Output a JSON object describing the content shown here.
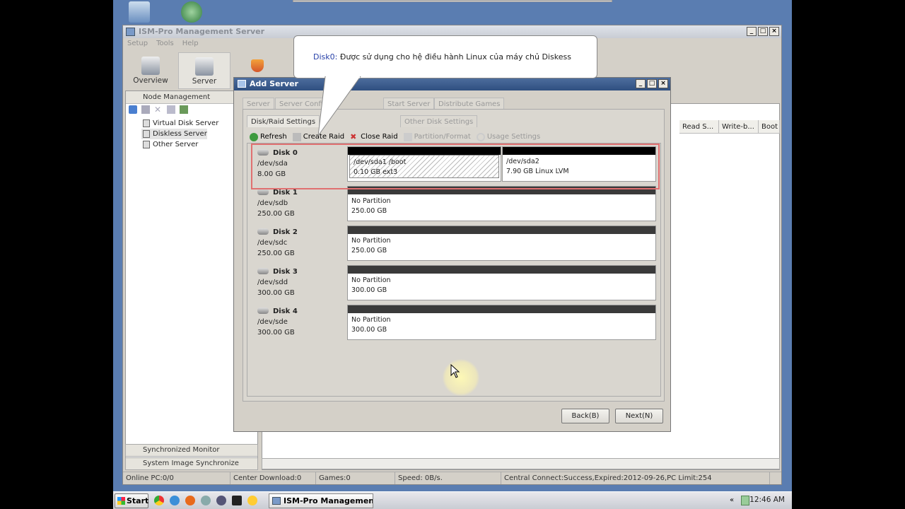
{
  "main_window": {
    "title": "ISM-Pro Management Server",
    "menu": [
      "Setup",
      "Tools",
      "Help"
    ],
    "nav": {
      "overview": "Overview",
      "server": "Server"
    }
  },
  "left_panel": {
    "header": "Node Management",
    "tree": [
      "Virtual Disk Server",
      "Diskless Server",
      "Other Server"
    ],
    "footer1": "Synchronized Monitor",
    "footer2": "System Image Synchronize"
  },
  "table_columns": [
    "Read S...",
    "Write-b...",
    "Boot"
  ],
  "status_bar": [
    "Online PC:0/0",
    "Center Download:0",
    "Games:0",
    "Speed: 0B/s.",
    "Central Connect:Success,Expired:2012-09-26,PC Limit:254"
  ],
  "dialog": {
    "title": "Add Server",
    "tabs": [
      "Server",
      "Server Config",
      "Start Server",
      "Distribute Games"
    ],
    "subtabs": [
      "Disk/Raid Settings",
      "Other Disk Settings"
    ],
    "toolbar": [
      "Refresh",
      "Create Raid",
      "Close Raid",
      "Partition/Format",
      "Usage Settings"
    ],
    "disks": [
      {
        "name": "Disk 0",
        "dev": "/dev/sda",
        "size": "8.00 GB",
        "partitions": [
          {
            "line1": "/dev/sda1 /boot",
            "line2": "0.10 GB ext3"
          },
          {
            "line1": "/dev/sda2",
            "line2": "7.90 GB Linux LVM"
          }
        ]
      },
      {
        "name": "Disk 1",
        "dev": "/dev/sdb",
        "size": "250.00 GB",
        "partitions": [
          {
            "line1": "No Partition",
            "line2": "250.00 GB"
          }
        ]
      },
      {
        "name": "Disk 2",
        "dev": "/dev/sdc",
        "size": "250.00 GB",
        "partitions": [
          {
            "line1": "No Partition",
            "line2": "250.00 GB"
          }
        ]
      },
      {
        "name": "Disk 3",
        "dev": "/dev/sdd",
        "size": "300.00 GB",
        "partitions": [
          {
            "line1": "No Partition",
            "line2": "300.00 GB"
          }
        ]
      },
      {
        "name": "Disk 4",
        "dev": "/dev/sde",
        "size": "300.00 GB",
        "partitions": [
          {
            "line1": "No Partition",
            "line2": "300.00 GB"
          }
        ]
      }
    ],
    "back_label": "Back(B)",
    "next_label": "Next(N)"
  },
  "callout": {
    "highlight": "Disk0:",
    "text": " Được sử dụng cho hệ điều hành Linux của máy chủ Diskess"
  },
  "taskbar": {
    "start": "Start",
    "task": "ISM-Pro Managemen...",
    "clock": "12:46 AM"
  }
}
